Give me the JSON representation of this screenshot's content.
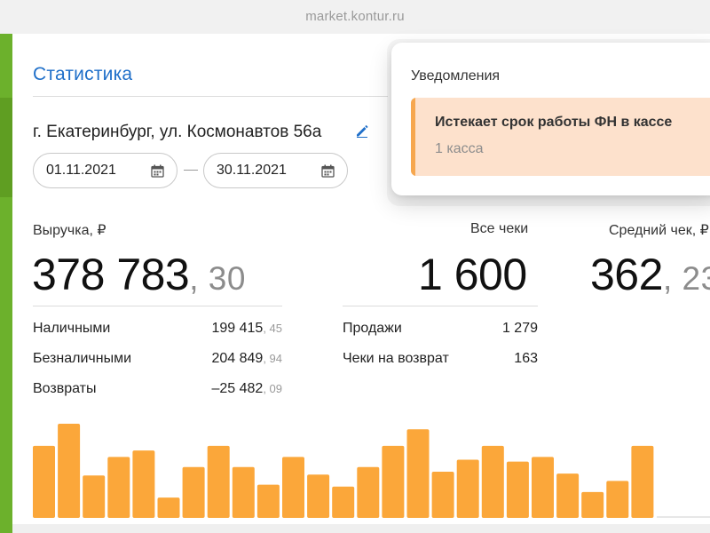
{
  "browser": {
    "url": "market.kontur.ru"
  },
  "page": {
    "title": "Статистика",
    "address": "г. Екатеринбург, ул. Космонавтов 56а",
    "date_from": "01.11.2021",
    "date_to": "30.11.2021"
  },
  "revenue": {
    "label": "Выручка, ₽",
    "value_int": "378 783",
    "value_frac": ", 30",
    "rows": [
      {
        "label": "Наличными",
        "int": "199 415",
        "frac": ", 45"
      },
      {
        "label": "Безналичными",
        "int": "204 849",
        "frac": ", 94"
      },
      {
        "label": "Возвраты",
        "int": "–25 482",
        "frac": ", 09"
      }
    ]
  },
  "checks": {
    "label": "Все чеки",
    "value": "1 600",
    "rows": [
      {
        "label": "Продажи",
        "value": "1 279"
      },
      {
        "label": "Чеки на возврат",
        "value": "163"
      }
    ]
  },
  "avg_check": {
    "label": "Средний чек, ₽",
    "value_int": "362",
    "value_frac": ", 23"
  },
  "notifications": {
    "heading": "Уведомления",
    "items": [
      {
        "title": "Истекает срок работы ФН в кассе",
        "subtitle": "1 касса"
      }
    ]
  },
  "colors": {
    "accent_green": "#6cb12c",
    "link_blue": "#1f6fc9",
    "bar_orange": "#fba73a",
    "notice_bg": "#fde1cc",
    "notice_accent": "#f6a74f"
  },
  "icons": [
    "edit-pencil-icon",
    "calendar-icon"
  ],
  "chart_data": {
    "type": "bar",
    "values": [
      78,
      102,
      46,
      66,
      73,
      22,
      55,
      78,
      55,
      36,
      66,
      47,
      34,
      55,
      78,
      96,
      50,
      63,
      78,
      61,
      66,
      48,
      28,
      40,
      78
    ]
  }
}
